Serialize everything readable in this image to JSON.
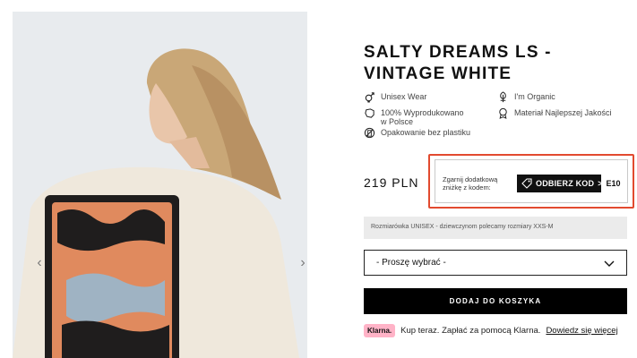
{
  "product": {
    "title": "SALTY DREAMS LS - VINTAGE WHITE",
    "price": "219 PLN"
  },
  "features": [
    {
      "icon": "gender-icon",
      "label": "Unisex Wear"
    },
    {
      "icon": "organic-icon",
      "label": "I'm Organic"
    },
    {
      "icon": "poland-map-icon",
      "label": "100% Wyprodukowano w Polsce"
    },
    {
      "icon": "quality-badge-icon",
      "label": "Materiał Najlepszej Jakości"
    },
    {
      "icon": "no-plastic-icon",
      "label": "Opakowanie bez plastiku"
    }
  ],
  "promo": {
    "text": "Zgarnij dodatkową zniżkę z kodem:",
    "button_label": "ODBIERZ KOD",
    "chevron": ">",
    "code_fragment": "E10",
    "border_color": "#e24a2f"
  },
  "size_note": "Rozmiarówka UNISEX - dziewczynom polecamy rozmiary XXS-M",
  "size_select": {
    "selected": "- Proszę wybrać -"
  },
  "cart_button": "DODAJ DO KOSZYKA",
  "klarna": {
    "badge": "Klarna.",
    "text": "Kup teraz. Zapłać za pomocą Klarna.",
    "link": "Dowiedz się więcej"
  },
  "gallery": {
    "prev_arrow": "‹",
    "next_arrow": "›"
  }
}
